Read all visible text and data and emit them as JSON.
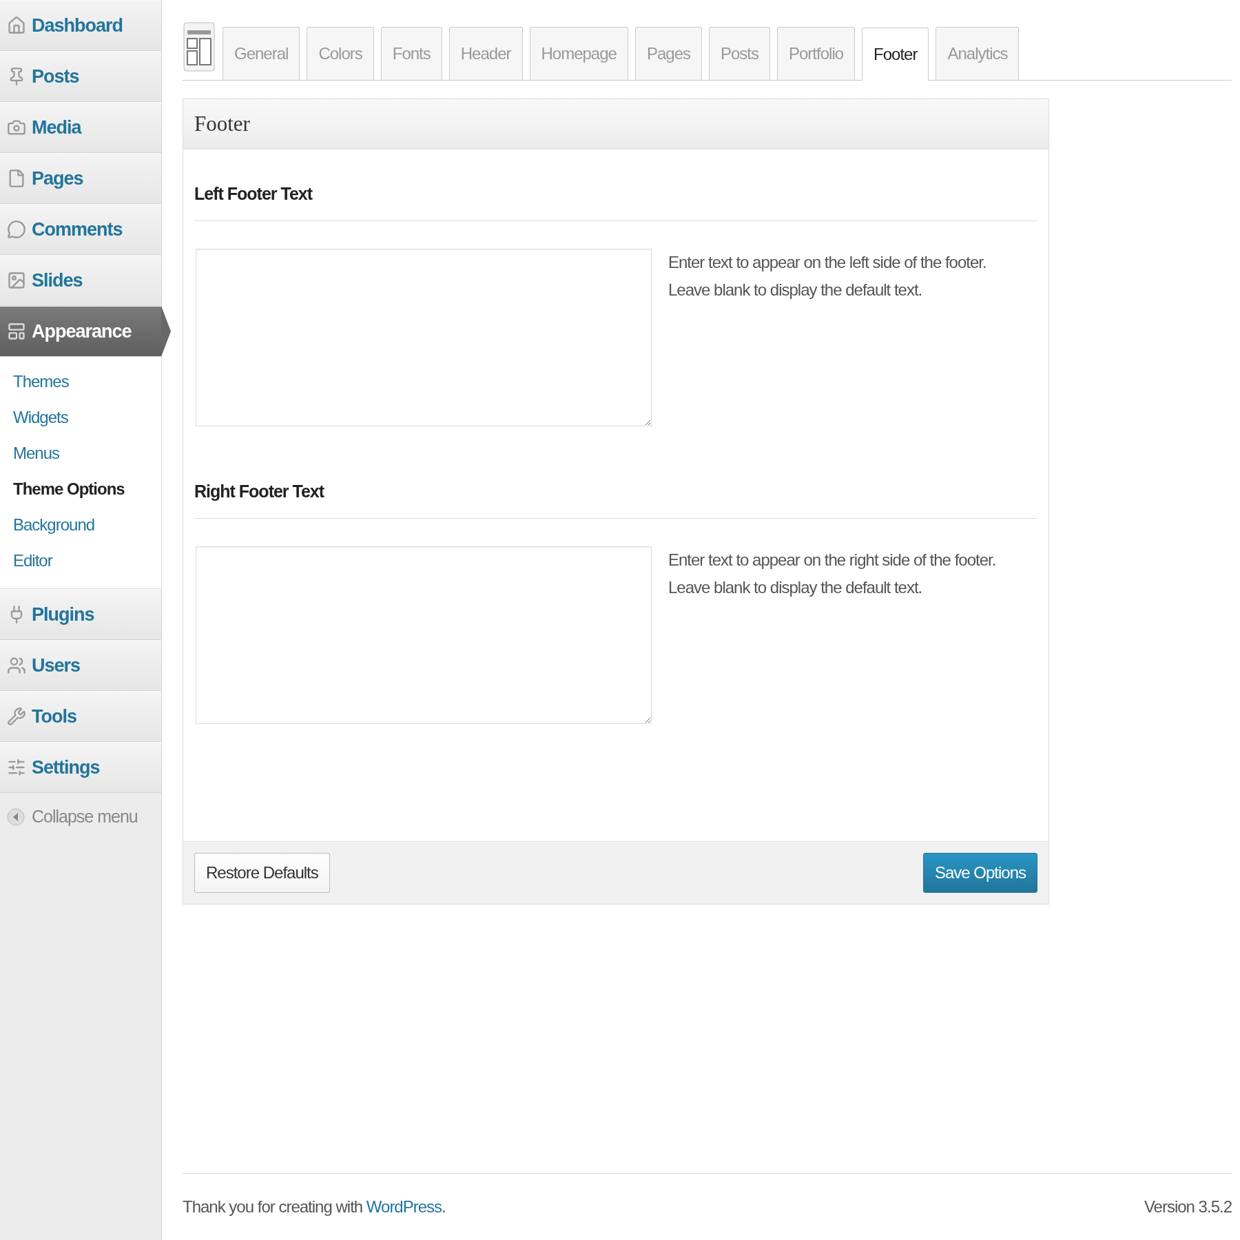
{
  "sidebar": {
    "items": [
      {
        "label": "Dashboard",
        "current": false
      },
      {
        "label": "Posts",
        "current": false
      },
      {
        "label": "Media",
        "current": false
      },
      {
        "label": "Pages",
        "current": false
      },
      {
        "label": "Comments",
        "current": false
      },
      {
        "label": "Slides",
        "current": false
      },
      {
        "label": "Appearance",
        "current": true,
        "children": [
          {
            "label": "Themes",
            "selected": false
          },
          {
            "label": "Widgets",
            "selected": false
          },
          {
            "label": "Menus",
            "selected": false
          },
          {
            "label": "Theme Options",
            "selected": true
          },
          {
            "label": "Background",
            "selected": false
          },
          {
            "label": "Editor",
            "selected": false
          }
        ]
      },
      {
        "label": "Plugins",
        "current": false
      },
      {
        "label": "Users",
        "current": false
      },
      {
        "label": "Tools",
        "current": false
      },
      {
        "label": "Settings",
        "current": false
      }
    ],
    "collapse": "Collapse menu"
  },
  "tabs": [
    {
      "label": "General",
      "selected": false
    },
    {
      "label": "Colors",
      "selected": false
    },
    {
      "label": "Fonts",
      "selected": false
    },
    {
      "label": "Header",
      "selected": false
    },
    {
      "label": "Homepage",
      "selected": false
    },
    {
      "label": "Pages",
      "selected": false
    },
    {
      "label": "Posts",
      "selected": false
    },
    {
      "label": "Portfolio",
      "selected": false
    },
    {
      "label": "Footer",
      "selected": true
    },
    {
      "label": "Analytics",
      "selected": false
    }
  ],
  "panel": {
    "title": "Footer",
    "fields": [
      {
        "label": "Left Footer Text",
        "description": "Enter text to appear on the left side of the footer.\nLeave blank to display the default text."
      },
      {
        "label": "Right Footer Text",
        "description": "Enter text to appear on the right side of the footer.\nLeave blank to display the default text."
      }
    ],
    "buttons": [
      {
        "label": "Restore Defaults",
        "kind": "secondary"
      },
      {
        "label": "Save Options",
        "kind": "primary"
      }
    ]
  },
  "footer": {
    "thanks": "Thank you for creating with",
    "link": "WordPress",
    "after": ".",
    "version": "Version 3.5.2"
  }
}
